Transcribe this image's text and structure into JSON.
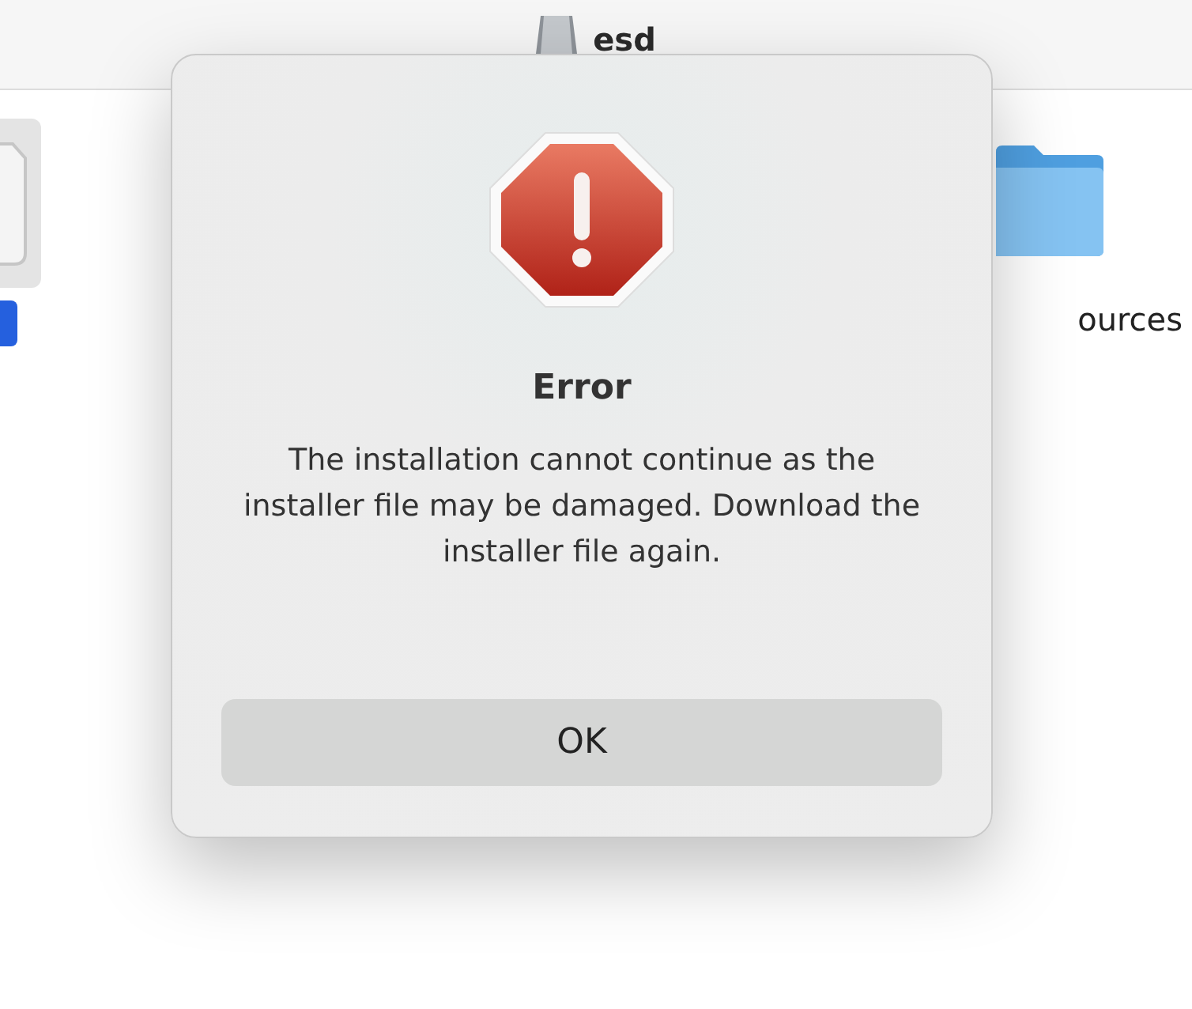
{
  "finder_window": {
    "title": "esd",
    "items": [
      {
        "selected": true
      },
      {
        "label": "ources",
        "selected": false
      }
    ]
  },
  "alert": {
    "title": "Error",
    "message": "The installation cannot continue as the installer file may be damaged. Download the installer file again.",
    "buttons": [
      "OK"
    ]
  }
}
